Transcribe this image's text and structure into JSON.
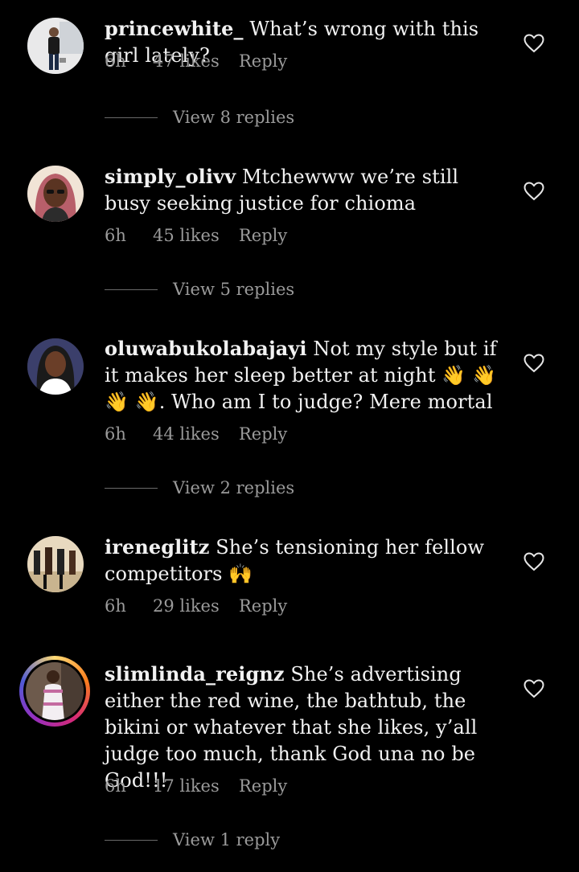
{
  "comments": [
    {
      "username": "princewhite_",
      "text": "What’s wrong with this girl lately?",
      "time": "6h",
      "likes": "47 likes",
      "reply": "Reply",
      "view_replies": "View 8 replies"
    },
    {
      "username": "simply_olivv",
      "text": "Mtchewww we’re still busy seeking justice for chioma",
      "time": "6h",
      "likes": "45 likes",
      "reply": "Reply",
      "view_replies": "View 5 replies"
    },
    {
      "username": "oluwabukolabajayi",
      "text_before": "Not my style but if it makes her sleep better at night",
      "emojis": "👋 👋 👋 👋",
      "text_after": ". Who am I to judge? Mere mortal",
      "time": "6h",
      "likes": "44 likes",
      "reply": "Reply",
      "view_replies": "View 2 replies"
    },
    {
      "username": "ireneglitz",
      "text": "She’s tensioning her fellow competitors",
      "emojis": "🙌",
      "time": "6h",
      "likes": "29 likes",
      "reply": "Reply"
    },
    {
      "username": "slimlinda_reignz",
      "text": "She’s advertising either the red wine, the bathtub, the bikini or whatever that she likes,  y’all judge too much, thank God una no be God!!!",
      "time": "6h",
      "likes": "17 likes",
      "reply": "Reply",
      "view_replies": "View 1 reply"
    }
  ],
  "icons": {
    "like": "heart-outline-icon"
  },
  "colors": {
    "background": "#000000",
    "text": "#f2f2f2",
    "meta": "#9a9a9a"
  }
}
